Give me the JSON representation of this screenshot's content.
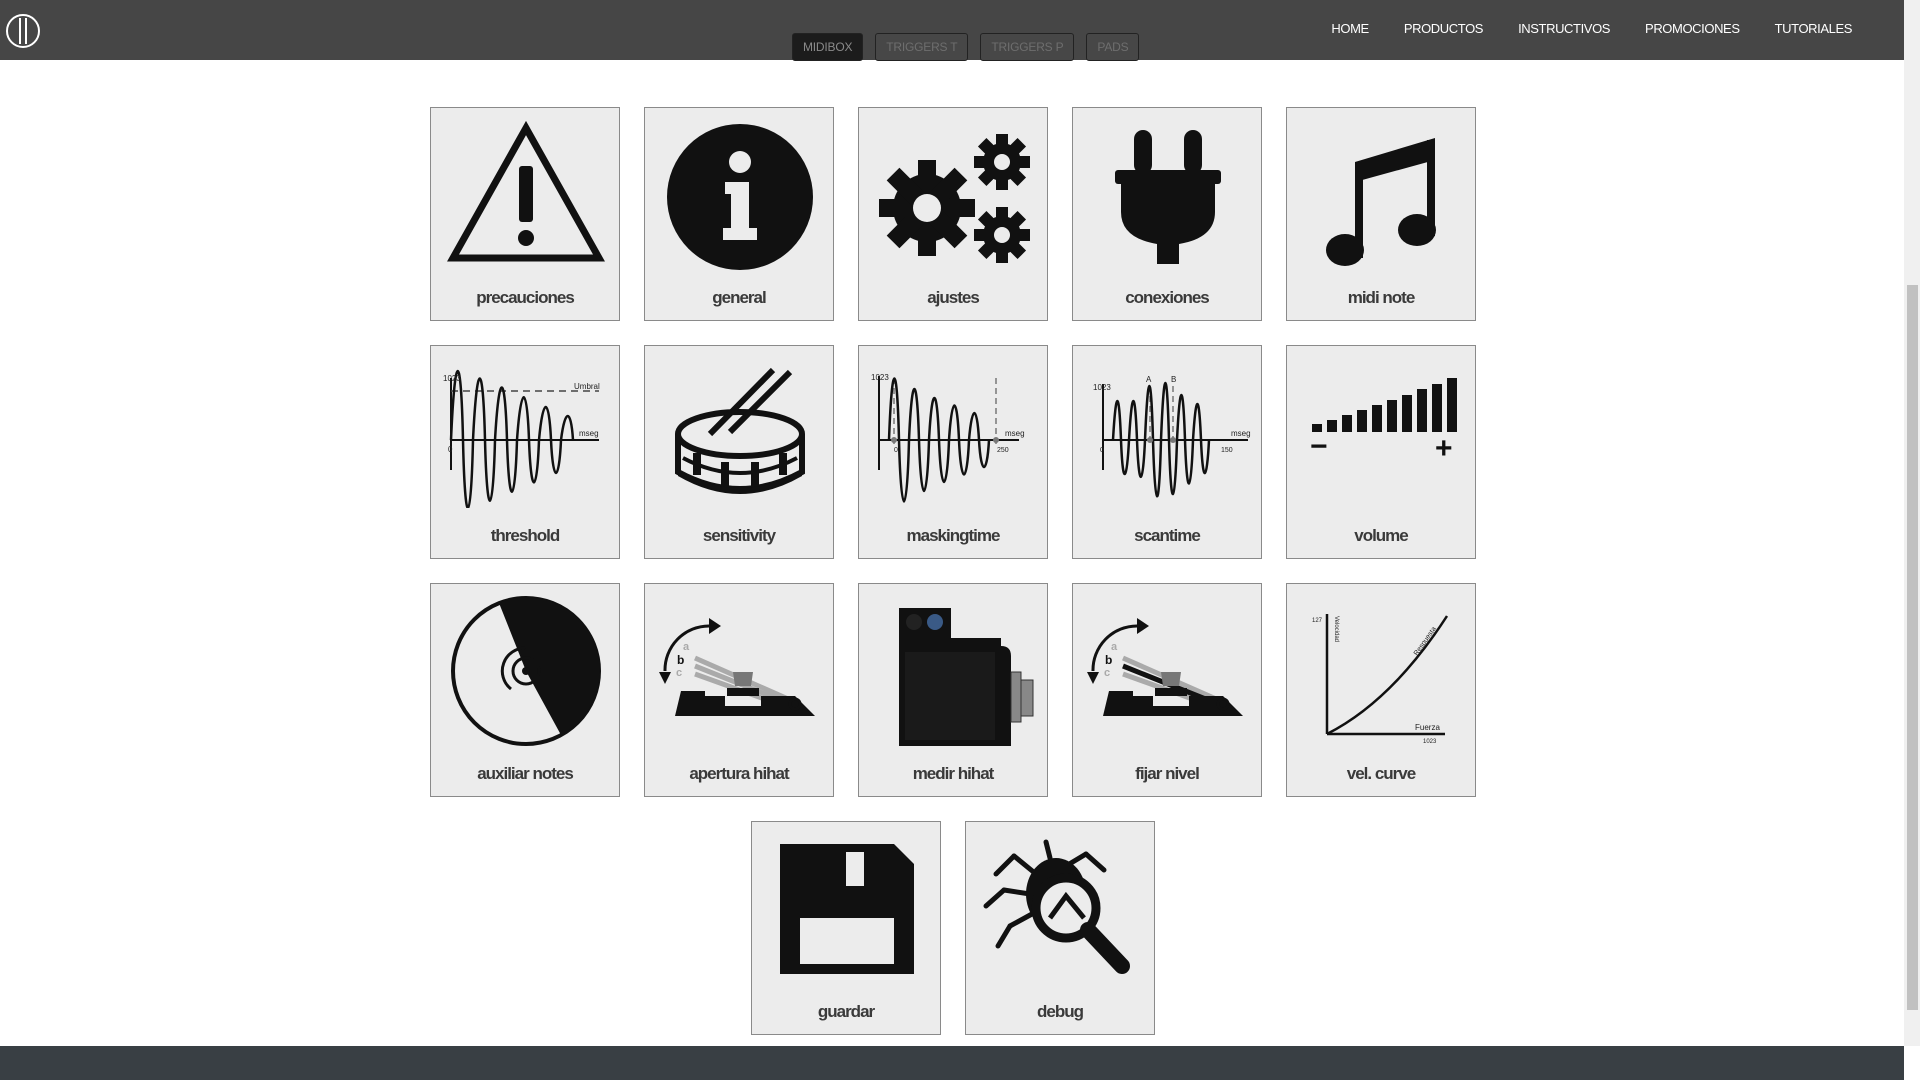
{
  "header": {
    "logo_icon": "brand-logo-icon",
    "subtabs": [
      {
        "label": "MIDIBOX",
        "active": true
      },
      {
        "label": "TRIGGERS T",
        "active": false
      },
      {
        "label": "TRIGGERS P",
        "active": false
      },
      {
        "label": "PADS",
        "active": false
      }
    ],
    "nav": [
      "HOME",
      "PRODUCTOS",
      "INSTRUCTIVOS",
      "PROMOCIONES",
      "TUTORIALES"
    ]
  },
  "tiles": [
    {
      "label": "precauciones",
      "icon": "warning-icon"
    },
    {
      "label": "general",
      "icon": "info-icon"
    },
    {
      "label": "ajustes",
      "icon": "gears-icon"
    },
    {
      "label": "conexiones",
      "icon": "plug-icon"
    },
    {
      "label": "midi note",
      "icon": "music-note-icon"
    },
    {
      "label": "threshold",
      "icon": "threshold-wave-icon",
      "chart_text": [
        "1023",
        "Umbral",
        "mseg",
        "0"
      ]
    },
    {
      "label": "sensitivity",
      "icon": "snare-drum-icon"
    },
    {
      "label": "maskingtime",
      "icon": "maskingtime-wave-icon",
      "chart_text": [
        "1023",
        "mseg",
        "0",
        "250"
      ]
    },
    {
      "label": "scantime",
      "icon": "scantime-wave-icon",
      "chart_text": [
        "1023",
        "A",
        "B",
        "mseg",
        "0",
        "150"
      ]
    },
    {
      "label": "volume",
      "icon": "volume-bars-icon",
      "chart_text": [
        "−",
        "+"
      ]
    },
    {
      "label": "auxiliar notes",
      "icon": "disc-icon"
    },
    {
      "label": "apertura hihat",
      "icon": "hihat-pedal-icon",
      "chart_text": [
        "a",
        "b",
        "c"
      ]
    },
    {
      "label": "medir hihat",
      "icon": "device-box-icon"
    },
    {
      "label": "fijar nivel",
      "icon": "hihat-pedal-level-icon",
      "chart_text": [
        "a",
        "b",
        "c"
      ]
    },
    {
      "label": "vel. curve",
      "icon": "velocity-curve-icon",
      "chart_text": [
        "127",
        "Velocidad",
        "Respuesta",
        "Fuerza",
        "1023"
      ]
    },
    {
      "label": "guardar",
      "icon": "save-disk-icon"
    },
    {
      "label": "debug",
      "icon": "bug-magnifier-icon"
    }
  ]
}
